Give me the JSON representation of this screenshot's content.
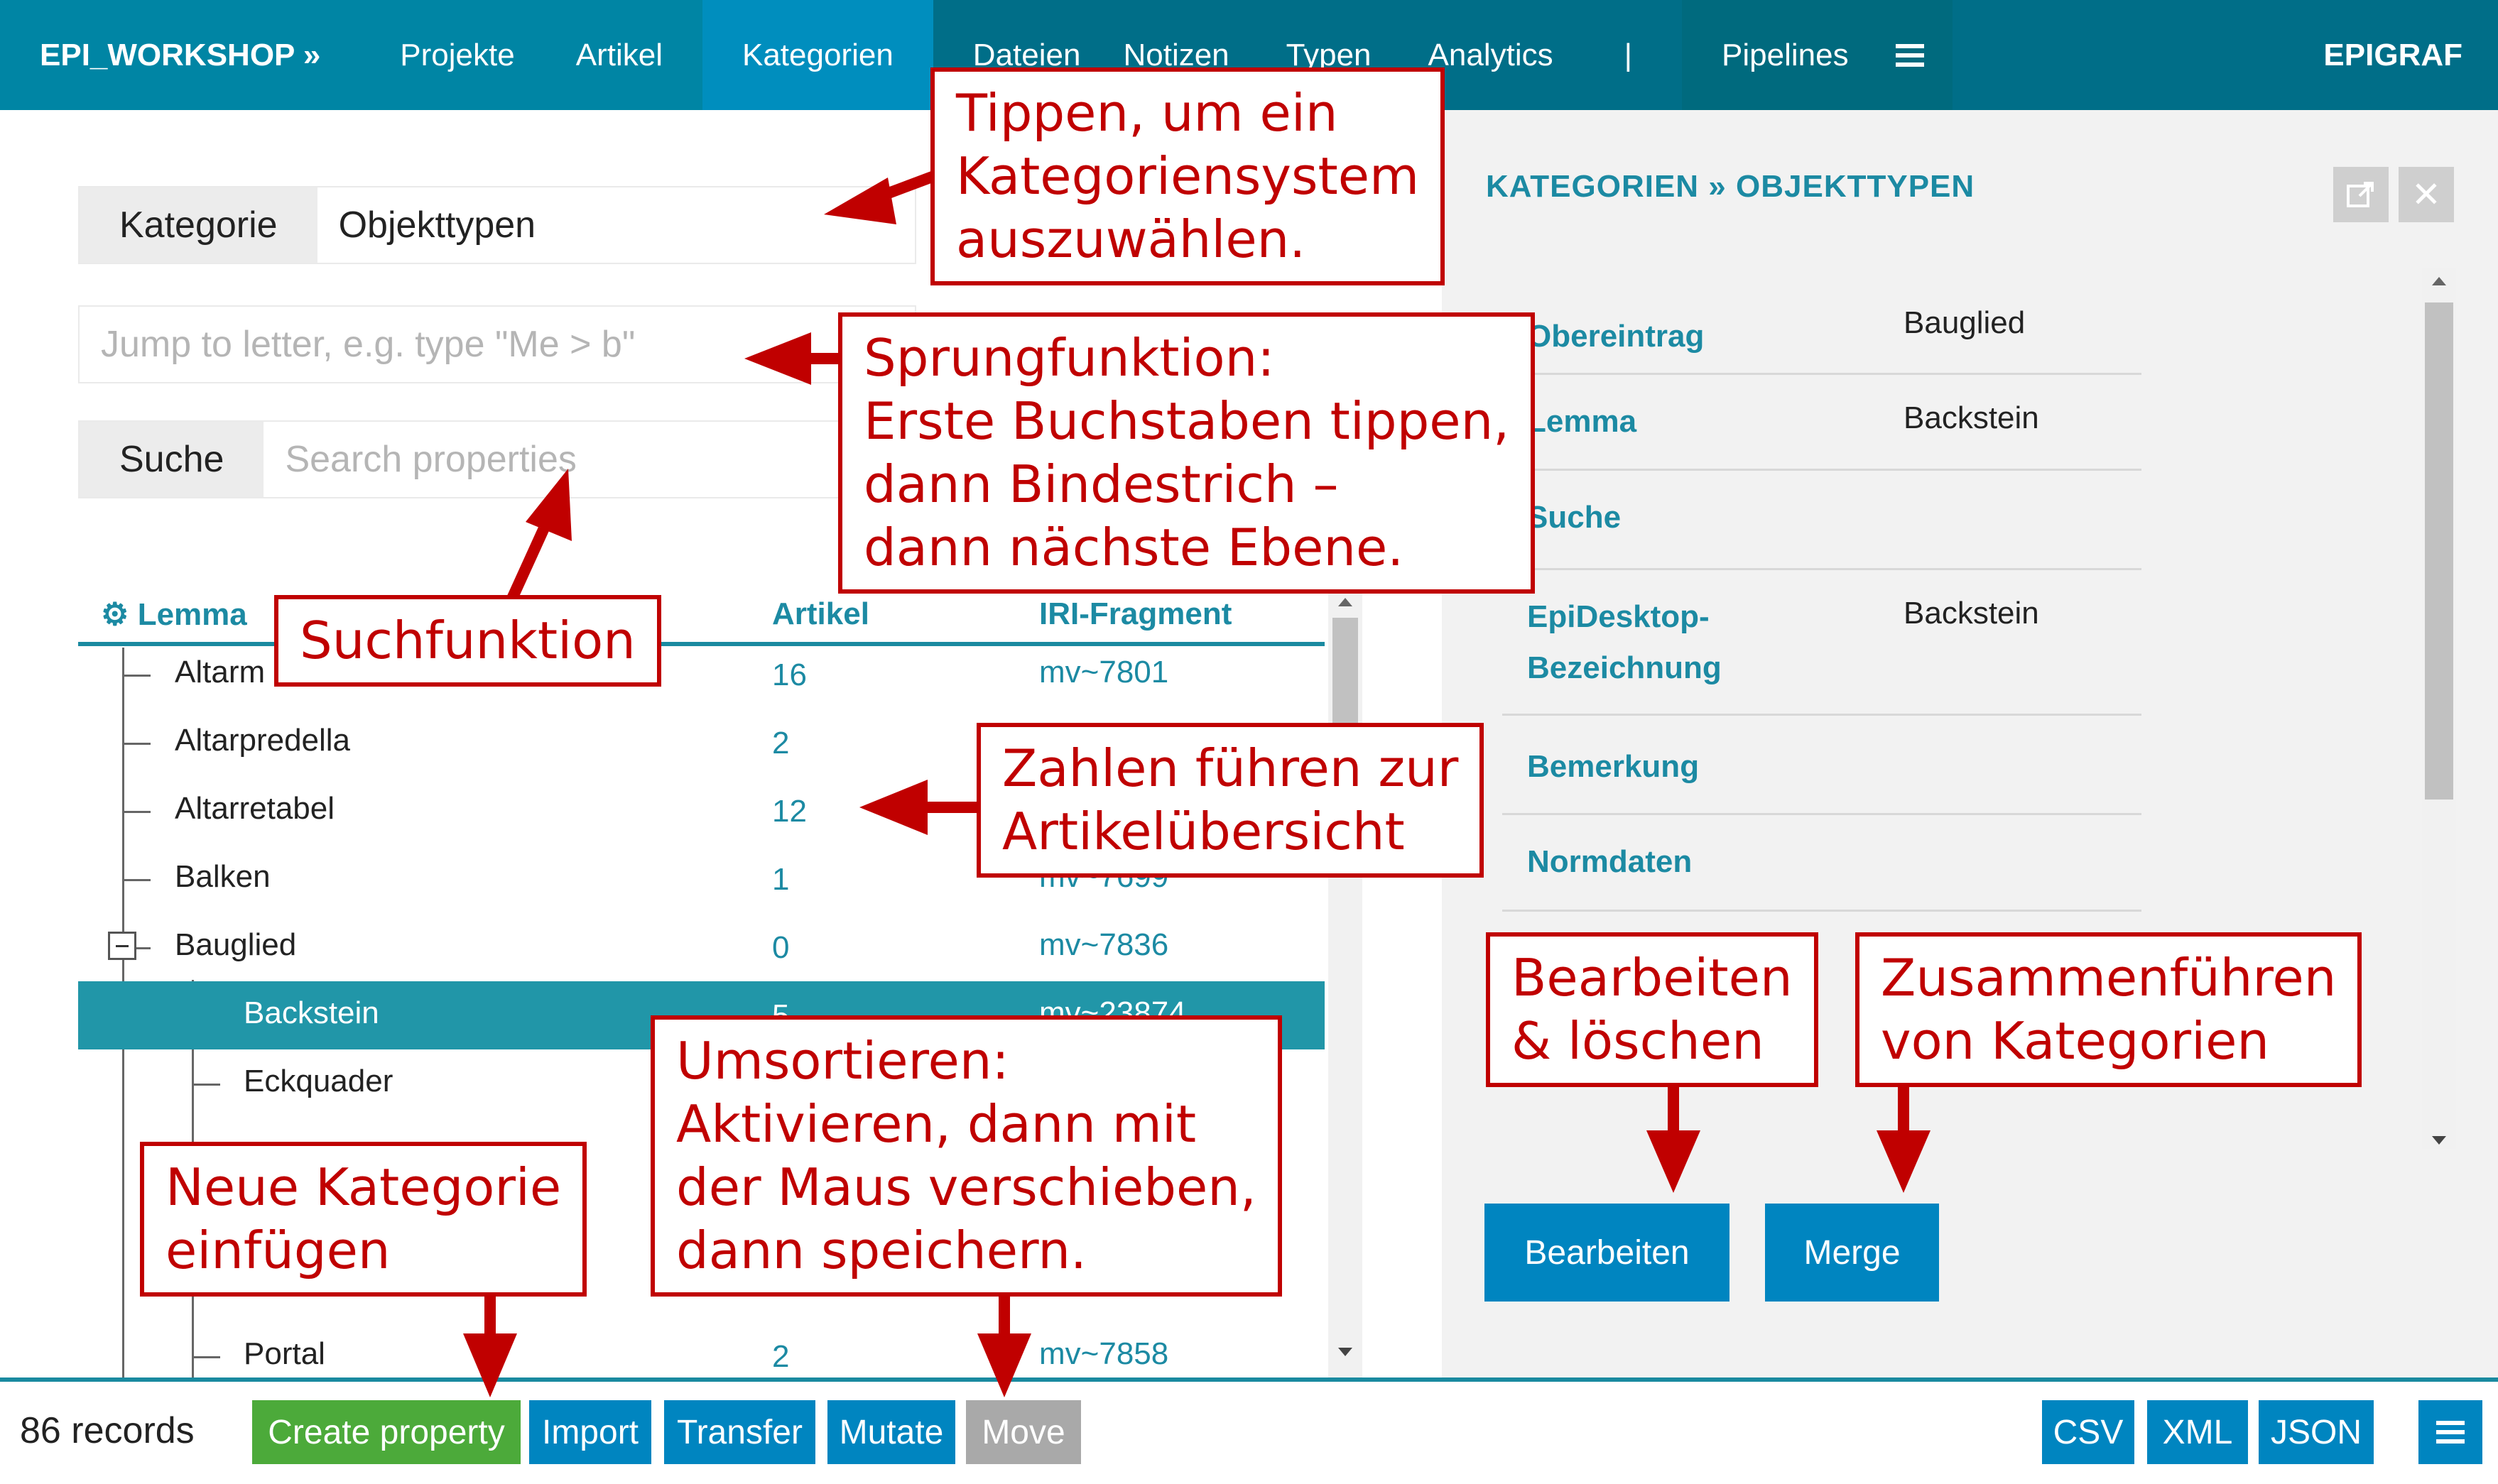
{
  "nav": {
    "brand": "EPI_WORKSHOP »",
    "items": [
      {
        "label": "Projekte"
      },
      {
        "label": "Artikel"
      },
      {
        "label": "Kategorien"
      },
      {
        "label": "Dateien"
      },
      {
        "label": "Notizen"
      },
      {
        "label": "Typen"
      },
      {
        "label": "Analytics"
      },
      {
        "label": "|"
      },
      {
        "label": "Pipelines"
      }
    ],
    "menu_icon": "hamburger-icon",
    "app_name": "EPIGRAF"
  },
  "filters": {
    "category_label": "Kategorie",
    "category_value": "Objekttypen",
    "jump_placeholder": "Jump to letter, e.g. type \"Me > b\"",
    "search_label": "Suche",
    "search_placeholder": "Search properties"
  },
  "tree": {
    "columns": {
      "lemma": "Lemma",
      "articles": "Artikel",
      "iri": "IRI-Fragment"
    },
    "rows": [
      {
        "label": "Altarm",
        "articles": "16",
        "iri": "mv~7801"
      },
      {
        "label": "Altarpredella",
        "articles": "2",
        "iri": ""
      },
      {
        "label": "Altarretabel",
        "articles": "12",
        "iri": ""
      },
      {
        "label": "Balken",
        "articles": "1",
        "iri": "mv~7699"
      },
      {
        "label": "Bauglied",
        "articles": "0",
        "iri": "mv~7836"
      },
      {
        "label": "Backstein",
        "articles": "5",
        "iri": "mv~23874"
      },
      {
        "label": "Eckquader",
        "articles": "",
        "iri": ""
      },
      {
        "label": "Portal",
        "articles": "2",
        "iri": "mv~7858"
      }
    ]
  },
  "detail": {
    "breadcrumb": "KATEGORIEN » OBJEKTTYPEN",
    "properties": [
      {
        "name": "Obereintrag",
        "value": "Bauglied"
      },
      {
        "name": "Lemma",
        "value": "Backstein"
      },
      {
        "name": "Suche",
        "value": ""
      },
      {
        "name": "EpiDesktop-Bezeichnung",
        "value": "Backstein"
      },
      {
        "name": "Bemerkung",
        "value": ""
      },
      {
        "name": "Normdaten",
        "value": ""
      }
    ],
    "edit_button": "Bearbeiten",
    "merge_button": "Merge"
  },
  "footer": {
    "records": "86 records",
    "buttons": {
      "create": "Create property",
      "import": "Import",
      "transfer": "Transfer",
      "mutate": "Mutate",
      "move": "Move",
      "csv": "CSV",
      "xml": "XML",
      "json": "JSON"
    }
  },
  "callouts": {
    "category": [
      "Tippen, um ein",
      "Kategoriensystem",
      "auszuwählen."
    ],
    "jump": [
      "Sprungfunktion:",
      "Erste Buchstaben tippen,",
      "dann Bindestrich –",
      "dann nächste Ebene."
    ],
    "search": [
      "Suchfunktion"
    ],
    "numbers": [
      "Zahlen führen zur",
      "Artikelübersicht"
    ],
    "edit": [
      "Bearbeiten",
      "& löschen"
    ],
    "merge": [
      "Zusammenführen",
      "von Kategorien"
    ],
    "reorder": [
      "Umsortieren:",
      "Aktivieren, dann mit",
      "der Maus verschieben,",
      "dann speichern."
    ],
    "new": [
      "Neue Kategorie",
      "einfügen"
    ]
  },
  "colors": {
    "nav": "#006e88",
    "accent": "#1c8aa3",
    "selected_row": "#2196a8",
    "button_blue": "#0085c0",
    "button_green": "#4caa3a",
    "callout_red": "#c00000"
  }
}
